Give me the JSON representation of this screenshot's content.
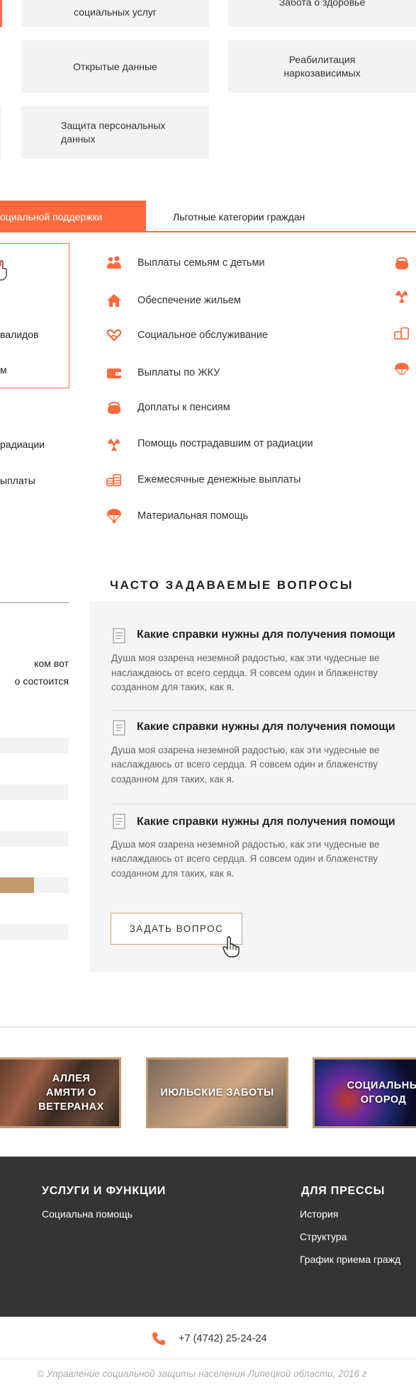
{
  "tiles": {
    "row0_left": "социальных услуг",
    "row0_right": "Забота о здоровье",
    "open_data": "Открытые данные",
    "rehab": "Реабилитация\nнаркозависимых",
    "personal_data": "Защита персональных\nданных"
  },
  "tabs": {
    "active": "оциальной поддержки",
    "second": "Льготные категории граждан"
  },
  "left_clipped": {
    "item1": "валидов",
    "item2": "м",
    "item3": "радиации",
    "item4": "ыплаты"
  },
  "services": [
    {
      "icon": "family-icon",
      "label": "Выплаты семьям с детьми"
    },
    {
      "icon": "house-icon",
      "label": "Обеспечение жильем"
    },
    {
      "icon": "heart-hand-icon",
      "label": "Социальное обслуживание"
    },
    {
      "icon": "wallet-icon",
      "label": "Выплаты по ЖКУ"
    },
    {
      "icon": "purse-icon",
      "label": "Доплаты к пенсиям"
    },
    {
      "icon": "radiation-icon",
      "label": "Помощь пострадавшим от радиации"
    },
    {
      "icon": "coins-icon",
      "label": "Ежемесячные денежные выплаты"
    },
    {
      "icon": "parachute-icon",
      "label": "Материальная помощь"
    }
  ],
  "faq": {
    "title": "ЧАСТО ЗАДАВАЕМЫЕ ВОПРОСЫ",
    "items": [
      {
        "q": "Какие справки нужны для получения помощи",
        "a1": "Душа моя озарена неземной радостью, как эти чудесные ве",
        "a2": "наслаждаюсь от всего сердца. Я совсем один и блаженству",
        "a3": "созданном для таких, как я."
      },
      {
        "q": "Какие справки нужны для получения помощи",
        "a1": "Душа моя озарена неземной радостью, как эти чудесные ве",
        "a2": "наслаждаюсь от всего сердца. Я совсем один и блаженству",
        "a3": "созданном для таких, как я."
      },
      {
        "q": "Какие справки нужны для получения помощи",
        "a1": "Душа моя озарена неземной радостью, как эти чудесные ве",
        "a2": "наслаждаюсь от всего сердца. Я совсем один и блаженству",
        "a3": "созданном для таких, как я."
      }
    ],
    "ask_button": "ЗАДАТЬ ВОПРОС"
  },
  "poll_left": {
    "line1": "ком вот",
    "line2": "о состоится",
    "bar_fill": 0.49
  },
  "banners": {
    "alley": "АЛЛЕЯ\nАМЯТИ О ВЕТЕРАНАХ",
    "july": "ИЮЛЬСКИЕ ЗАБОТЫ",
    "garden": "СОЦИАЛЬНЫ\nОГОРОД"
  },
  "footer": {
    "col1_title": "УСЛУГИ И ФУНКЦИИ",
    "col1_links": [
      "Социальна помощь"
    ],
    "col2_title": "ДЛЯ ПРЕССЫ",
    "col2_links": [
      "История",
      "Структура",
      "График приема гражд"
    ]
  },
  "contact": {
    "phone": "+7 (4742) 25-24-24"
  },
  "copyright": "© Управление социальной защиты населения Липецкой области, 2016 г",
  "colors": {
    "accent": "#ff6a3d",
    "gold": "#c49a6c",
    "footer_bg": "#343434"
  }
}
